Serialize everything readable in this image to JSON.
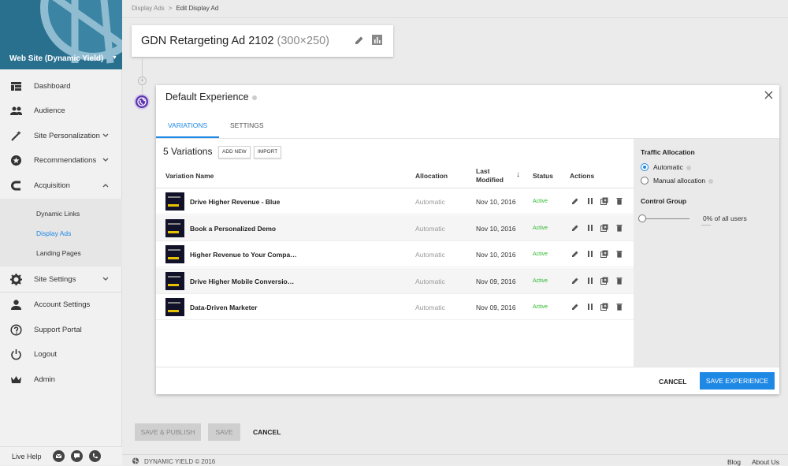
{
  "sidebar": {
    "site_name": "Web Site (Dynamic Yield)",
    "items": [
      {
        "label": "Dashboard",
        "icon": "dashboard-icon"
      },
      {
        "label": "Audience",
        "icon": "people-icon"
      },
      {
        "label": "Site Personalization",
        "icon": "magic-wand-icon"
      },
      {
        "label": "Recommendations",
        "icon": "star-badge-icon"
      },
      {
        "label": "Acquisition",
        "icon": "magnet-icon"
      },
      {
        "label": "Site Settings",
        "icon": "gear-icon"
      },
      {
        "label": "Account Settings",
        "icon": "person-icon"
      },
      {
        "label": "Support Portal",
        "icon": "help-icon"
      },
      {
        "label": "Logout",
        "icon": "power-icon"
      },
      {
        "label": "Admin",
        "icon": "crown-icon"
      }
    ],
    "sub_items": [
      {
        "label": "Dynamic Links"
      },
      {
        "label": "Display Ads"
      },
      {
        "label": "Landing Pages"
      }
    ],
    "live_help": "Live Help"
  },
  "breadcrumb": {
    "parent": "Display Ads",
    "separator": ">",
    "current": "Edit Display Ad"
  },
  "ad": {
    "name": "GDN Retargeting Ad 2102",
    "size": "(300×250)"
  },
  "experience": {
    "title": "Default Experience",
    "tabs": [
      {
        "label": "VARIATIONS"
      },
      {
        "label": "SETTINGS"
      }
    ],
    "variations_count": "5 Variations",
    "add_new": "ADD NEW",
    "import": "IMPORT",
    "columns": {
      "name": "Variation Name",
      "allocation": "Allocation",
      "last_modified_1": "Last",
      "last_modified_2": "Modified",
      "sort": "↓",
      "status": "Status",
      "actions": "Actions"
    },
    "rows": [
      {
        "name": "Drive Higher Revenue - Blue",
        "allocation": "Automatic",
        "modified": "Nov 10, 2016",
        "status": "Active"
      },
      {
        "name": "Book a Personalized Demo",
        "allocation": "Automatic",
        "modified": "Nov 10, 2016",
        "status": "Active"
      },
      {
        "name": "Higher Revenue to Your Compa…",
        "allocation": "Automatic",
        "modified": "Nov 10, 2016",
        "status": "Active"
      },
      {
        "name": "Drive Higher Mobile Conversio…",
        "allocation": "Automatic",
        "modified": "Nov 09, 2016",
        "status": "Active"
      },
      {
        "name": "Data-Driven Marketer",
        "allocation": "Automatic",
        "modified": "Nov 09, 2016",
        "status": "Active"
      }
    ],
    "traffic": {
      "title": "Traffic Allocation",
      "automatic": "Automatic",
      "manual": "Manual allocation",
      "control_group": "Control Group",
      "control_value": "0",
      "control_suffix": "% of all users",
      "control_fraction": 0
    },
    "cancel": "CANCEL",
    "save": "SAVE EXPERIENCE"
  },
  "footer_buttons": {
    "save_publish": "SAVE & PUBLISH",
    "save": "SAVE",
    "cancel": "CANCEL"
  },
  "footer": {
    "copyright": "DYNAMIC YIELD  ©  2016",
    "blog": "Blog",
    "about": "About Us"
  },
  "colors": {
    "accent": "#1e88e5",
    "brand": "#29708f",
    "active_status": "#2eb82e",
    "experience_badge": "#5e35b1"
  }
}
